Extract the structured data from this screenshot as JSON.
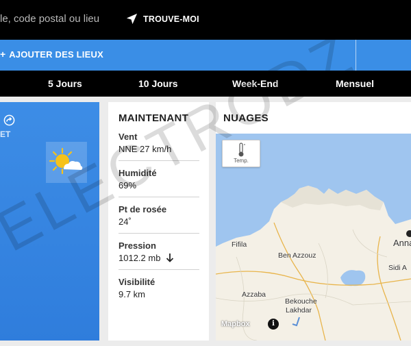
{
  "header": {
    "search_placeholder": "le, code postal ou lieu",
    "locate_label": "TROUVE-MOI",
    "locate_icon": "navigation-arrow-icon"
  },
  "places_bar": {
    "add_label": "AJOUTER DES LIEUX",
    "background": "#3a8ee6"
  },
  "tabs": [
    {
      "label": "5 Jours"
    },
    {
      "label": "10 Jours"
    },
    {
      "label": "Week-End"
    },
    {
      "label": "Mensuel"
    }
  ],
  "current_card": {
    "partial_label": "ET",
    "icon": "partly-sunny-icon"
  },
  "now": {
    "title": "MAINTENANT",
    "metrics": [
      {
        "label": "Vent",
        "value": "NNE 27 km/h"
      },
      {
        "label": "Humidité",
        "value": "69%"
      },
      {
        "label": "Pt de rosée",
        "value": "24˚"
      },
      {
        "label": "Pression",
        "value": "1012.2 mb",
        "trend": "down"
      },
      {
        "label": "Visibilité",
        "value": "9.7 km"
      }
    ]
  },
  "map": {
    "title": "NUAGES",
    "layer_button": "Temp.",
    "places": [
      "Fifila",
      "Ben Azzouz",
      "Annaba",
      "Sidi A",
      "Azzaba",
      "Bekouche Lakhdar"
    ],
    "attribution": "Mapbox",
    "info": "i"
  },
  "watermark": "ELECTRODZ",
  "colors": {
    "blue": "#3a8ee6",
    "sea": "#9fc5ef",
    "land": "#f4f0e6",
    "black": "#000000"
  }
}
